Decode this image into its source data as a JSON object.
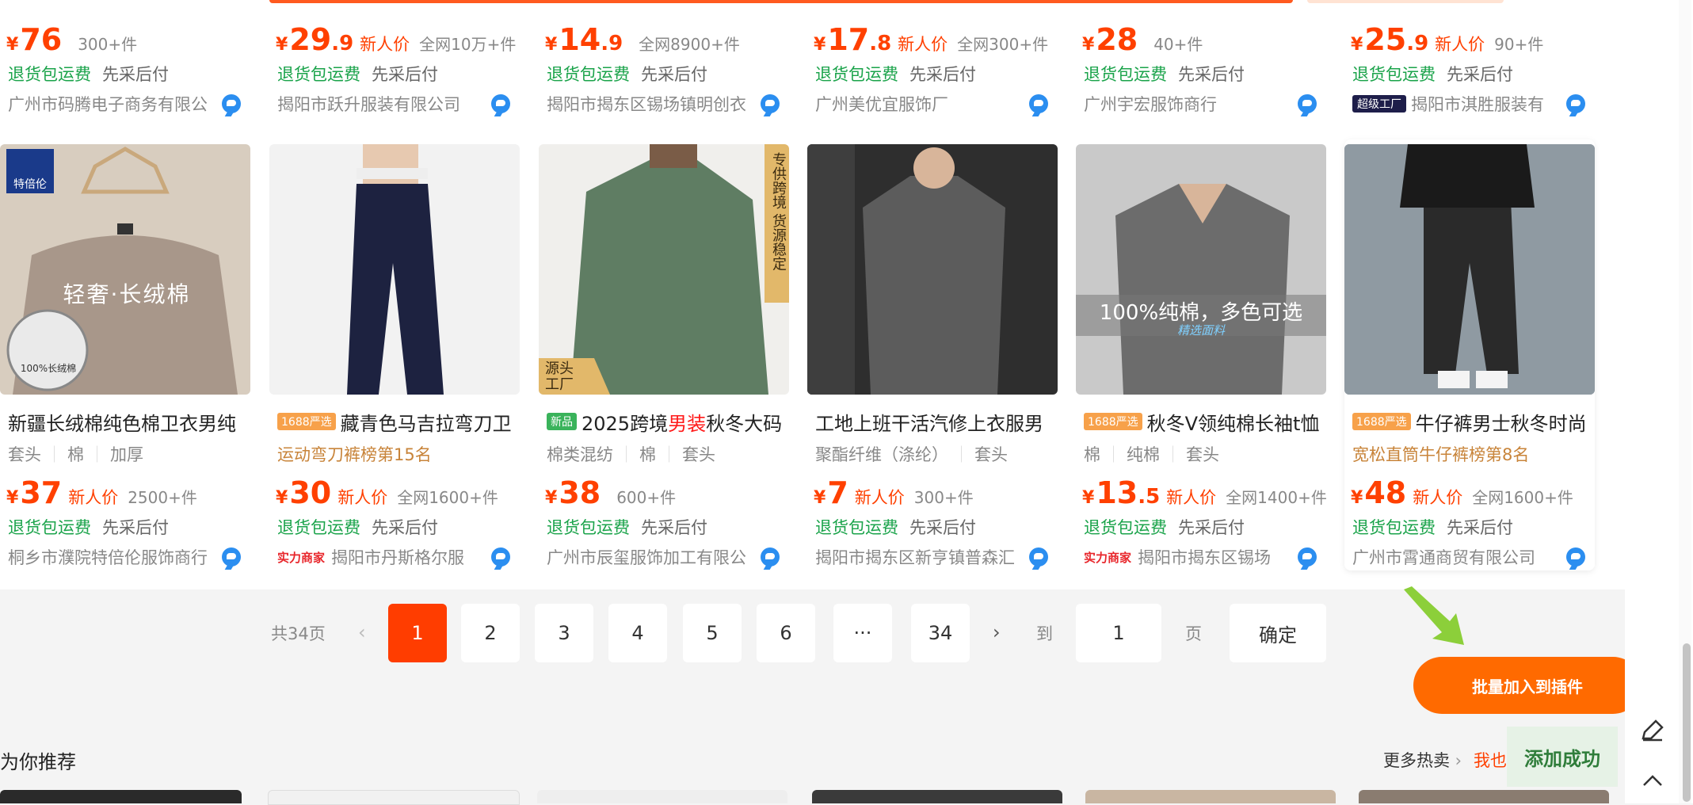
{
  "top_row": [
    {
      "price_int": "76",
      "price_dec": "",
      "new_label": "",
      "sales": "300+件",
      "svc1": "退货包运费",
      "svc2": "先采后付",
      "shop": "广州市码腾电子商务有限公",
      "badge": ""
    },
    {
      "price_int": "29",
      "price_dec": ".9",
      "new_label": "新人价",
      "sales": "全网10万+件",
      "svc1": "退货包运费",
      "svc2": "先采后付",
      "shop": "揭阳市跃升服装有限公司",
      "badge": ""
    },
    {
      "price_int": "14",
      "price_dec": ".9",
      "new_label": "",
      "sales": "全网8900+件",
      "svc1": "退货包运费",
      "svc2": "先采后付",
      "shop": "揭阳市揭东区锡场镇明创衣",
      "badge": ""
    },
    {
      "price_int": "17",
      "price_dec": ".8",
      "new_label": "新人价",
      "sales": "全网300+件",
      "svc1": "退货包运费",
      "svc2": "先采后付",
      "shop": "广州美优宜服饰厂",
      "badge": ""
    },
    {
      "price_int": "28",
      "price_dec": "",
      "new_label": "",
      "sales": "40+件",
      "svc1": "退货包运费",
      "svc2": "先采后付",
      "shop": "广州宇宏服饰商行",
      "badge": ""
    },
    {
      "price_int": "25",
      "price_dec": ".9",
      "new_label": "新人价",
      "sales": "90+件",
      "svc1": "退货包运费",
      "svc2": "先采后付",
      "shop": "揭阳市淇胜服装有",
      "badge": "超级工厂"
    }
  ],
  "products": [
    {
      "tag": "",
      "title": "新疆长绒棉纯色棉卫衣男纯",
      "attrs": [
        "套头",
        "棉",
        "加厚"
      ],
      "rank": "",
      "price_int": "37",
      "price_dec": "",
      "new_label": "新人价",
      "sales": "2500+件",
      "svc1": "退货包运费",
      "svc2": "先采后付",
      "shop": "桐乡市濮院特倍伦服饰商行",
      "badge": "",
      "img_brand": "特倍伦",
      "img_text": "轻奢·长绒棉",
      "img_sub": "100%长绒棉"
    },
    {
      "tag": "1688严选",
      "title": "藏青色马吉拉弯刀卫",
      "attrs": [],
      "rank": "运动弯刀裤榜第15名",
      "price_int": "30",
      "price_dec": "",
      "new_label": "新人价",
      "sales": "全网1600+件",
      "svc1": "退货包运费",
      "svc2": "先采后付",
      "shop": "揭阳市丹斯格尔服",
      "badge": "实力商家"
    },
    {
      "tag": "新品",
      "title_pre": "2025跨境",
      "title_hl": "男装",
      "title_post": "秋冬大码",
      "attrs": [
        "棉类混纺",
        "棉",
        "套头"
      ],
      "rank": "",
      "price_int": "38",
      "price_dec": "",
      "new_label": "",
      "sales": "600+件",
      "svc1": "退货包运费",
      "svc2": "先采后付",
      "shop": "广州市辰玺服饰加工有限公",
      "badge": "",
      "img_side": "专供跨境 货源稳定",
      "img_corner": "源头工厂"
    },
    {
      "tag": "",
      "title": "工地上班干活汽修上衣服男",
      "attrs": [
        "聚酯纤维（涤纶）",
        "套头"
      ],
      "rank": "",
      "price_int": "7",
      "price_dec": "",
      "new_label": "新人价",
      "sales": "300+件",
      "svc1": "退货包运费",
      "svc2": "先采后付",
      "shop": "揭阳市揭东区新亨镇普森汇",
      "badge": ""
    },
    {
      "tag": "1688严选",
      "title": "秋冬V领纯棉长袖t恤",
      "attrs": [
        "棉",
        "纯棉",
        "套头"
      ],
      "rank": "",
      "price_int": "13",
      "price_dec": ".5",
      "new_label": "新人价",
      "sales": "全网1400+件",
      "svc1": "退货包运费",
      "svc2": "先采后付",
      "shop": "揭阳市揭东区锡场",
      "badge": "实力商家",
      "img_text": "100%纯棉，多色可选",
      "img_sub": "精选面料"
    },
    {
      "tag": "1688严选",
      "title": "牛仔裤男士秋冬时尚",
      "attrs": [],
      "rank": "宽松直筒牛仔裤榜第8名",
      "price_int": "48",
      "price_dec": "",
      "new_label": "新人价",
      "sales": "全网1600+件",
      "svc1": "退货包运费",
      "svc2": "先采后付",
      "shop": "广州市霄通商贸有限公司",
      "badge": ""
    }
  ],
  "yen": "¥",
  "pagination": {
    "total": "共34页",
    "prev": "‹",
    "pages": [
      "1",
      "2",
      "3",
      "4",
      "5",
      "6"
    ],
    "ellipsis": "···",
    "last": "34",
    "next": "›",
    "goto_label": "到",
    "page_value": "1",
    "page_suffix": "页",
    "confirm": "确定"
  },
  "recommend": {
    "title": "为你推荐",
    "more": "更多热卖",
    "mine": "我也"
  },
  "plugin": {
    "batch_label": "批量加入到插件",
    "toast": "添加成功"
  },
  "icons": {
    "edit": "edit-icon",
    "up": "chevron-up-icon",
    "chat": "chat-icon",
    "arrow": "pointer-arrow"
  },
  "colors": {
    "accent": "#ff4000",
    "green": "#1aa34a",
    "plugin": "#ff6a00"
  }
}
